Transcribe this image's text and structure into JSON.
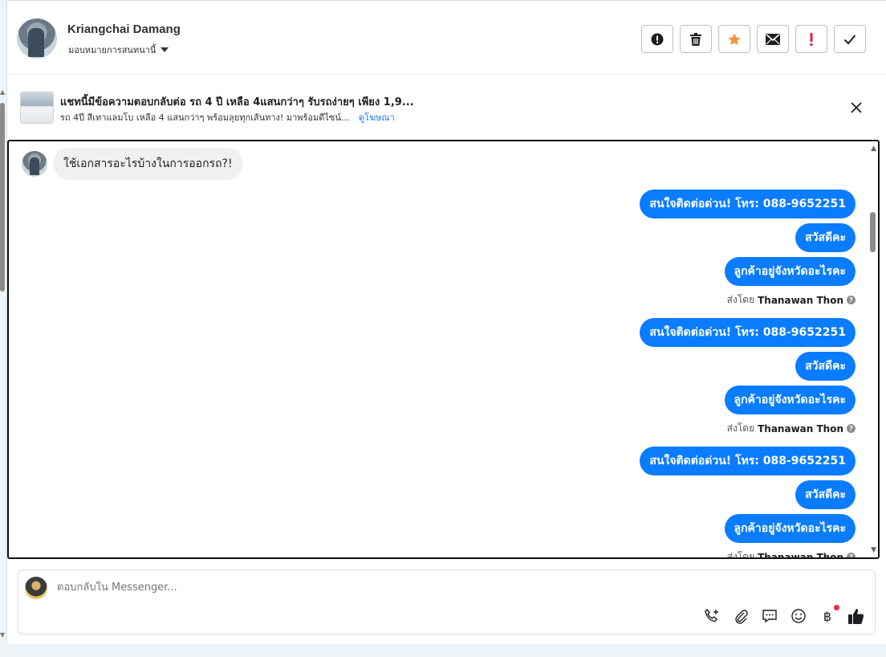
{
  "header": {
    "contact_name": "Kriangchai Damang",
    "assign_label": "มอบหมายการสนทนานี้",
    "actions": [
      {
        "name": "report-spam-button",
        "icon": "alert-circle-icon"
      },
      {
        "name": "delete-button",
        "icon": "trash-icon"
      },
      {
        "name": "star-button",
        "icon": "star-icon",
        "color": "#f7923a"
      },
      {
        "name": "mark-unread-button",
        "icon": "envelope-icon"
      },
      {
        "name": "follow-up-button",
        "icon": "exclamation-icon",
        "color": "#e41e3f"
      },
      {
        "name": "mark-done-button",
        "icon": "check-icon"
      }
    ]
  },
  "ad": {
    "title": "แชทนี้มีข้อความตอบกลับต่อ รถ 4 ปี เหลือ 4แสนกว่าๆ รับรถง่ายๆ เพียง 1,9...",
    "subtitle": "รถ 4ปี สีเทาแลมโบ เหลือ 4 แสนกว่าๆ พร้อมลุยทุกเส้นทาง! มาพร้อมดีไซน์...",
    "link_label": "ดูโฆษณา"
  },
  "messages": {
    "incoming": "ใช้เอกสารอะไรบ้างในการออกรถ?!",
    "groups": [
      {
        "bubbles": [
          "สนใจติดต่อด่วน! โทร: 088-9652251",
          "สวัสดีคะ",
          "ลูกค้าอยู่จังหวัดอะไรคะ"
        ],
        "sent_prefix": "ส่งโดย",
        "sender": "Thanawan Thon"
      },
      {
        "bubbles": [
          "สนใจติดต่อด่วน! โทร: 088-9652251",
          "สวัสดีคะ",
          "ลูกค้าอยู่จังหวัดอะไรคะ"
        ],
        "sent_prefix": "ส่งโดย",
        "sender": "Thanawan Thon"
      },
      {
        "bubbles": [
          "สนใจติดต่อด่วน! โทร: 088-9652251",
          "สวัสดีคะ",
          "ลูกค้าอยู่จังหวัดอะไรคะ"
        ],
        "sent_prefix": "ส่งโดย",
        "sender": "Thanawan Thon"
      }
    ]
  },
  "composer": {
    "placeholder": "ตอบกลับใน Messenger...",
    "currency_symbol": "฿"
  },
  "colors": {
    "outgoing_bubble": "#0a7cff",
    "link": "#1877f2"
  }
}
